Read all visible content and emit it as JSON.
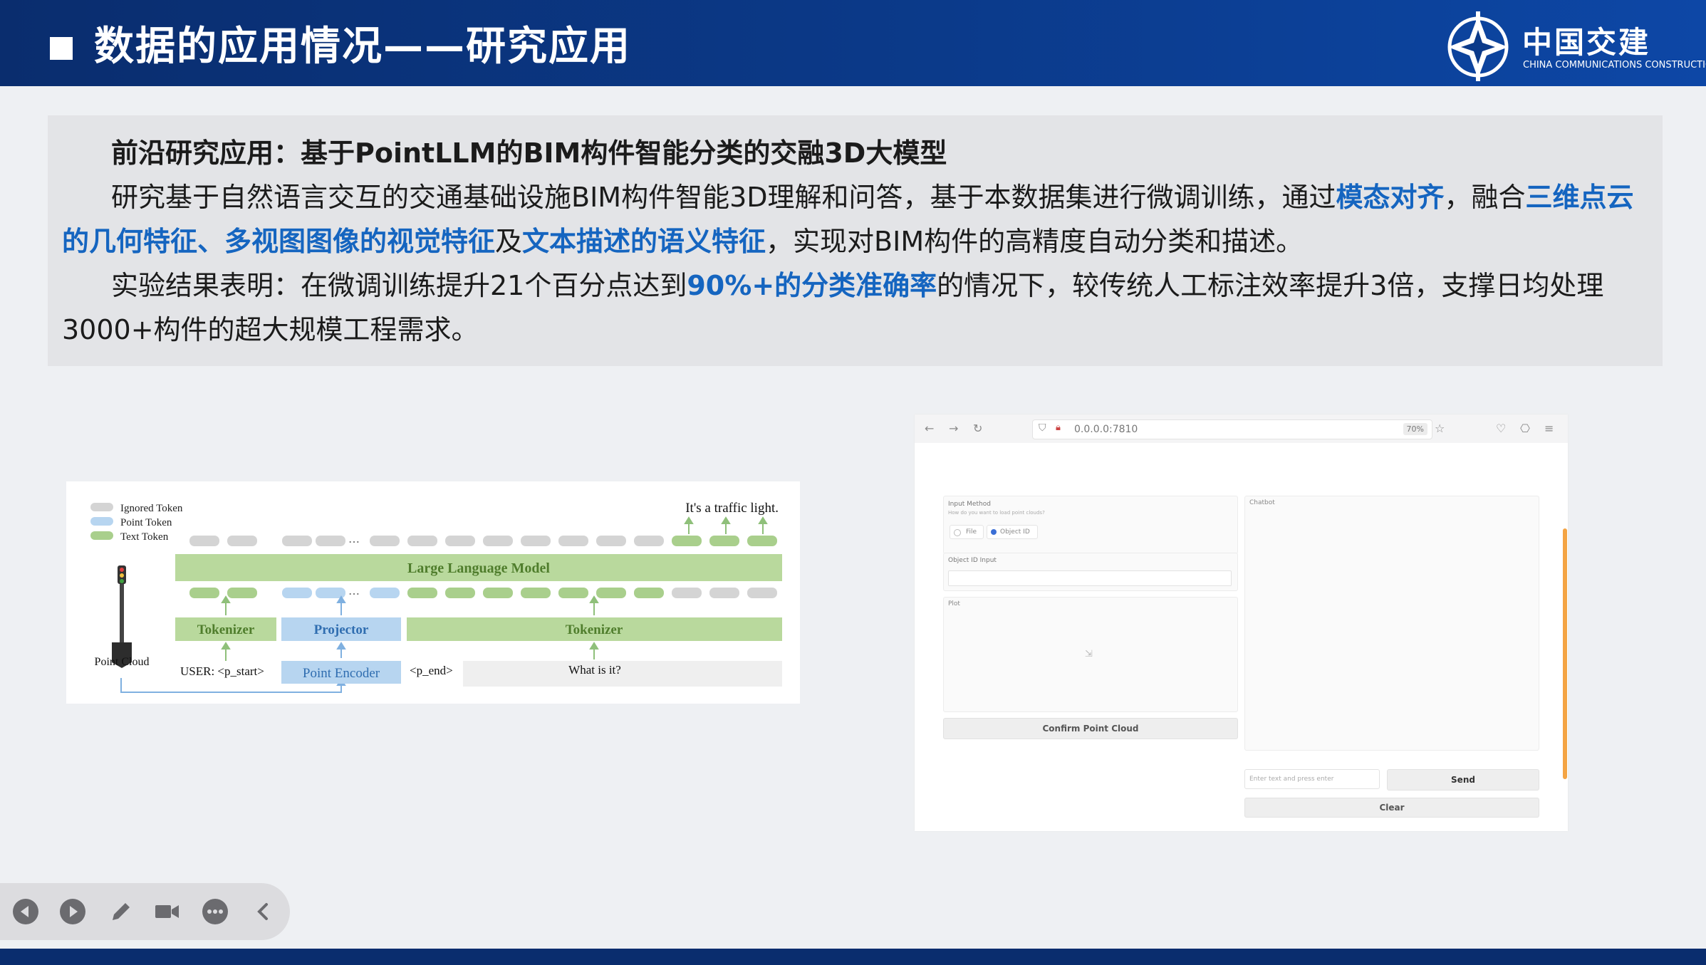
{
  "header": {
    "title": "数据的应用情况——研究应用",
    "logo_cn": "中国交建",
    "logo_en": "CHINA COMMUNICATIONS CONSTRUCTION"
  },
  "content": {
    "heading": "前沿研究应用：基于PointLLM的BIM构件智能分类的交融3D大模型",
    "body": {
      "part1": "研究基于自然语言交互的交通基础设施BIM构件智能3D理解和问答，基于本数据集进行微调训练，通过",
      "hl1": "模态对齐",
      "part2": "，融合",
      "hl2": "三维点云的几何特征、多视图图像的视觉特征",
      "part3": "及",
      "hl3": "文本描述的语义特征",
      "part4": "，实现对BIM构件的高精度自动分类和描述。"
    },
    "result": {
      "part1": "实验结果表明：在微调训练提升21个百分点达到",
      "hl1": "90%+的分类准确率",
      "part2": "的情况下，较传统人工标注效率提升3倍，支撑日均处理3000+构件的超大规模工程需求。"
    }
  },
  "diagram": {
    "legend": [
      "Ignored Token",
      "Point Token",
      "Text Token"
    ],
    "output_text": "It's a traffic light.",
    "llm_label": "Large Language Model",
    "tokenizer_label": "Tokenizer",
    "projector_label": "Projector",
    "encoder_label": "Point Encoder",
    "point_cloud_label": "Point Cloud",
    "user_prefix": "USER: <p_start>",
    "p_end": "<p_end>",
    "question": "What is it?",
    "colors": {
      "ignored": "#d4d4d4",
      "point": "#b7d5f0",
      "text": "#a9cf8c",
      "llm_fill": "#b9d99d",
      "llm_text": "#4f7d2c",
      "projector_text": "#2f6db0"
    }
  },
  "browser": {
    "url": "0.0.0.0:7810",
    "zoom": "70%",
    "input_method_label": "Input Method",
    "input_method_hint": "How do you want to load point clouds?",
    "radio_file": "File",
    "radio_object_id": "Object ID",
    "object_id_label": "Object ID Input",
    "plot_label": "Plot",
    "chatbot_label": "Chatbot",
    "confirm_button": "Confirm Point Cloud",
    "chat_placeholder": "Enter text and press enter",
    "send_button": "Send",
    "clear_button": "Clear"
  },
  "controls": [
    "previous-icon",
    "play-icon",
    "pen-icon",
    "camera-icon",
    "more-icon",
    "collapse-icon"
  ]
}
